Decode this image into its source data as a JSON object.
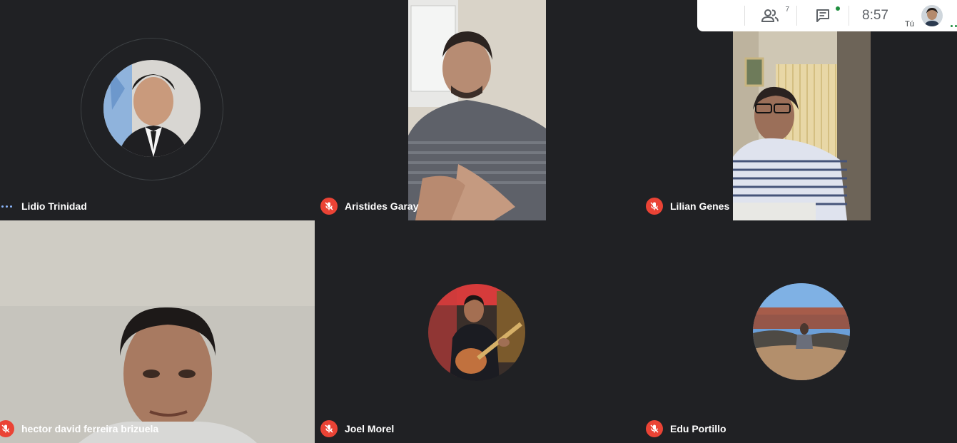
{
  "topbar": {
    "participants_count": "7",
    "clock": "8:57",
    "you_label": "Tú",
    "icons": [
      "people-icon",
      "chat-icon"
    ]
  },
  "participants": [
    {
      "name": "Lidio Trinidad",
      "muted": false,
      "speaking": true,
      "display": "avatar"
    },
    {
      "name": "Aristides Garay",
      "muted": true,
      "display": "video"
    },
    {
      "name": "Lilian Genes",
      "muted": true,
      "display": "video"
    },
    {
      "name": "hector david ferreira brizuela",
      "muted": true,
      "display": "video"
    },
    {
      "name": "Joel Morel",
      "muted": true,
      "display": "avatar"
    },
    {
      "name": "Edu Portillo",
      "muted": true,
      "display": "avatar"
    }
  ],
  "colors": {
    "background": "#202124",
    "mic_off": "#ea4335",
    "speaking_dots": "#8ab4f8",
    "topbar_bg": "#ffffff"
  }
}
